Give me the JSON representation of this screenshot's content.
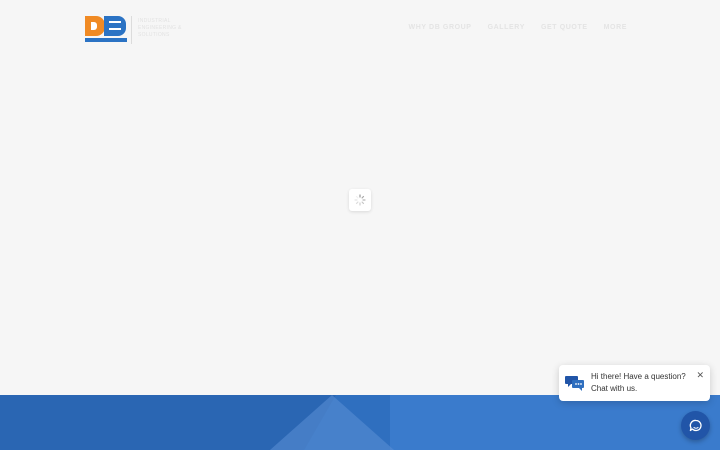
{
  "header": {
    "logo": {
      "text_lines": [
        "Industrial",
        "Engineering &",
        "Solutions"
      ]
    },
    "nav": [
      {
        "label": "Why DB Group"
      },
      {
        "label": "Gallery"
      },
      {
        "label": "Get Quote"
      },
      {
        "label": "More"
      }
    ]
  },
  "chat": {
    "greeting_line1": "Hi there! Have a question?",
    "greeting_line2": "Chat with us.",
    "close_symbol": "✕",
    "icon": "chat-bubbles-icon",
    "launcher_icon": "chat-launcher-icon"
  },
  "colors": {
    "background": "#f6f6f6",
    "brand_orange": "#f08a24",
    "brand_blue": "#2b73c4",
    "footer_blue": "#2f6fbf",
    "launcher_blue": "#2155a8"
  }
}
